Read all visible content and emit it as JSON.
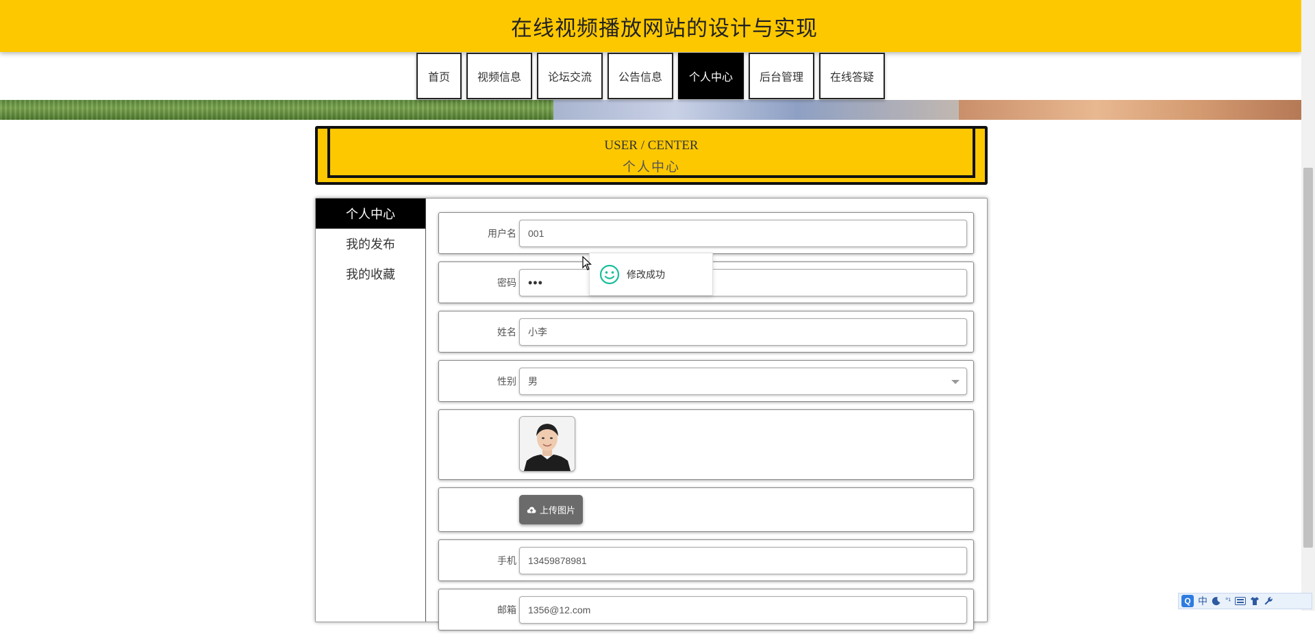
{
  "header": {
    "title": "在线视频播放网站的设计与实现"
  },
  "nav": {
    "items": [
      {
        "label": "首页"
      },
      {
        "label": "视频信息"
      },
      {
        "label": "论坛交流"
      },
      {
        "label": "公告信息"
      },
      {
        "label": "个人中心"
      },
      {
        "label": "后台管理"
      },
      {
        "label": "在线答疑"
      }
    ],
    "active": "个人中心"
  },
  "section": {
    "title_en": "USER / CENTER",
    "title_cn": "个人中心"
  },
  "sidebar": {
    "items": [
      {
        "label": "个人中心"
      },
      {
        "label": "我的发布"
      },
      {
        "label": "我的收藏"
      }
    ]
  },
  "form": {
    "username": {
      "label": "用户名",
      "value": "001"
    },
    "password": {
      "label": "密码",
      "value": "•••"
    },
    "name": {
      "label": "姓名",
      "value": "小李"
    },
    "gender": {
      "label": "性别",
      "value": "男"
    },
    "upload_label": "上传图片",
    "phone": {
      "label": "手机",
      "value": "13459878981"
    },
    "email": {
      "label": "邮箱",
      "value": "1356@12.com"
    }
  },
  "toast": {
    "message": "修改成功"
  },
  "ime": {
    "mode": "中",
    "extra": "°¹"
  },
  "colors": {
    "accent": "#fec800",
    "active_nav": "#000000",
    "toast_icon": "#19be9b"
  }
}
